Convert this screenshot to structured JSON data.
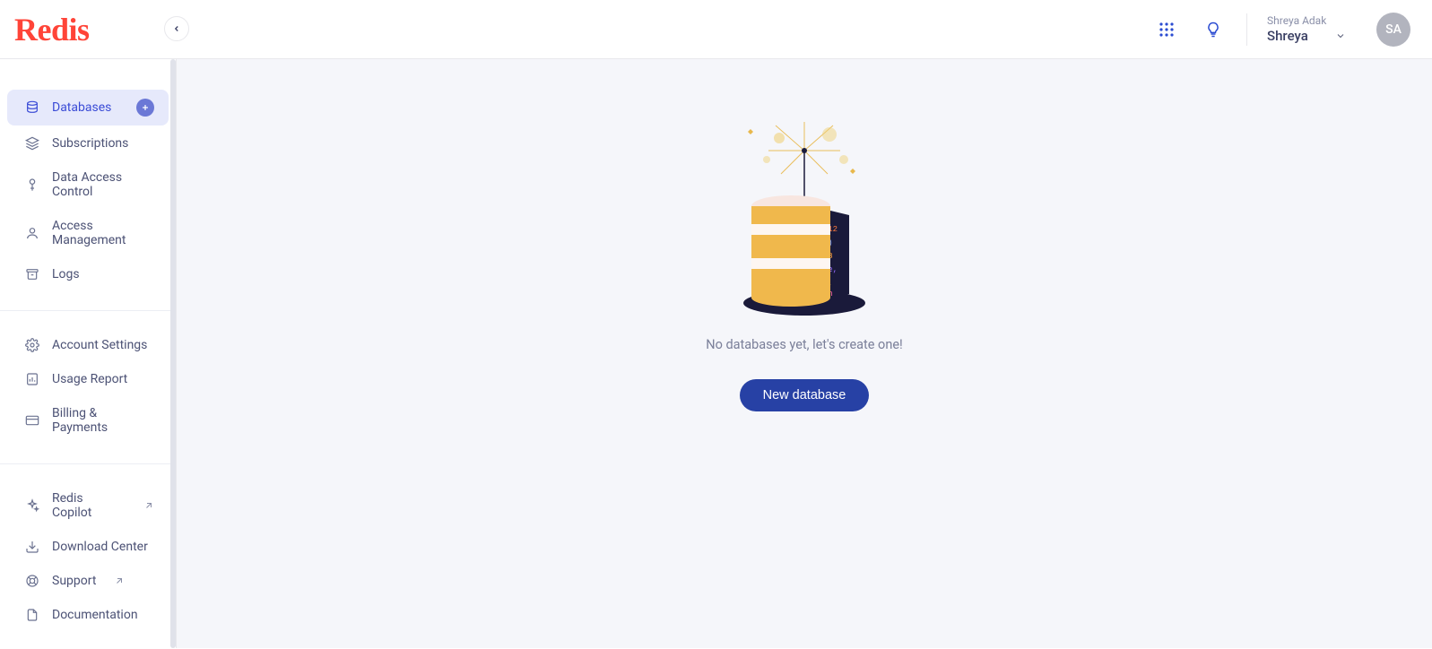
{
  "header": {
    "logo_text": "Redis",
    "user_full_name": "Shreya Adak",
    "user_account": "Shreya",
    "avatar_initials": "SA"
  },
  "sidebar": {
    "items": [
      {
        "label": "Databases",
        "active": true,
        "has_plus": true
      },
      {
        "label": "Subscriptions"
      },
      {
        "label": "Data Access Control"
      },
      {
        "label": "Access Management"
      },
      {
        "label": "Logs"
      }
    ],
    "settings": [
      {
        "label": "Account Settings"
      },
      {
        "label": "Usage Report"
      },
      {
        "label": "Billing & Payments"
      }
    ],
    "links": [
      {
        "label": "Redis Copilot",
        "external": true
      },
      {
        "label": "Download Center"
      },
      {
        "label": "Support",
        "external": true
      },
      {
        "label": "Documentation",
        "external": true
      }
    ]
  },
  "main": {
    "empty_message": "No databases yet, let's create one!",
    "new_db_label": "New database"
  }
}
